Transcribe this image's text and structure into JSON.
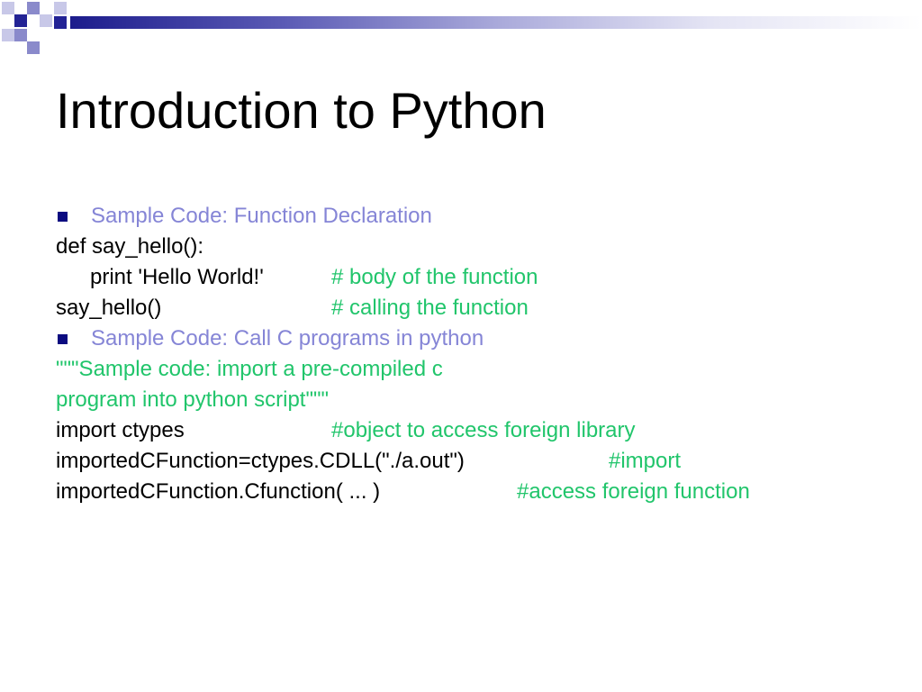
{
  "title": "Introduction to Python",
  "bullets": [
    "Sample Code: Function Declaration",
    "Sample Code: Call C programs in python"
  ],
  "code_lines": {
    "def_line": "def say_hello():",
    "print_line": "print 'Hello World!'",
    "print_comment": "# body of the function",
    "call_line": "say_hello()",
    "call_comment": "# calling the function",
    "docstring_1": "\"\"\"Sample code: import a pre-compiled c",
    "docstring_2": "program into python script\"\"\"",
    "import_line": "import ctypes",
    "import_comment": "#object to access foreign library",
    "cdll_line": "importedCFunction=ctypes.CDLL(\"./a.out\")",
    "cdll_comment": "#import",
    "access_line": "importedCFunction.Cfunction( ... )",
    "access_comment": "#access foreign function"
  },
  "colors": {
    "bullet_marker": "#0b0b80",
    "bullet_text": "#8585d6",
    "comment": "#21c56b",
    "code": "#000000",
    "header_dark": "#232395"
  }
}
